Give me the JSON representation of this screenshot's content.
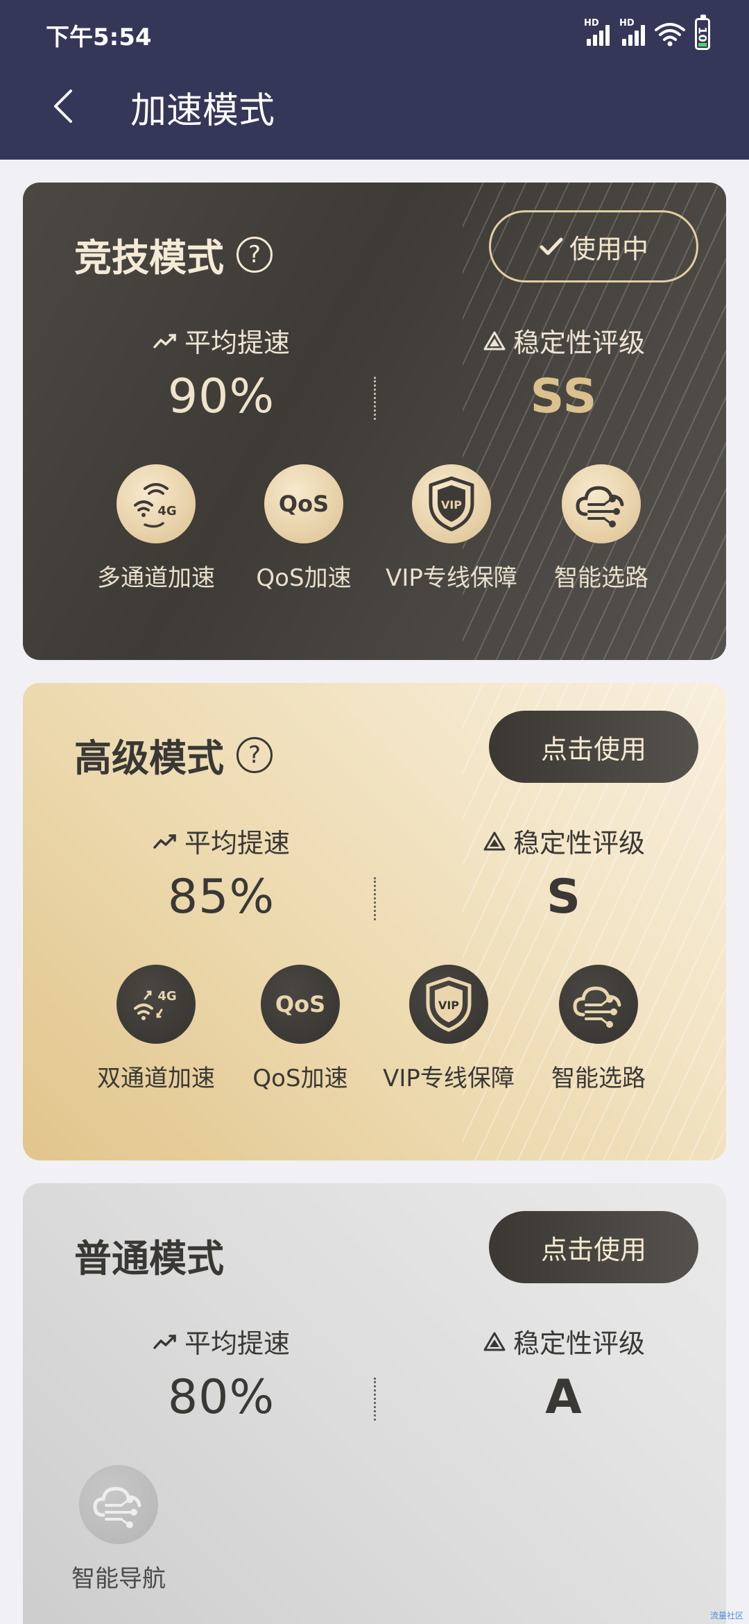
{
  "status_bar": {
    "time": "下午5:54",
    "signal1_label": "HD",
    "signal2_label": "HD",
    "battery_level": "10"
  },
  "nav": {
    "title": "加速模式"
  },
  "labels": {
    "avg_speed": "平均提速",
    "stability": "稳定性评级"
  },
  "cards": [
    {
      "title": "竞技模式",
      "help": "?",
      "button": "使用中",
      "avg_speed_value": "90%",
      "stability_value": "SS",
      "features": [
        "多通道加速",
        "QoS加速",
        "VIP专线保障",
        "智能选路"
      ]
    },
    {
      "title": "高级模式",
      "help": "?",
      "button": "点击使用",
      "avg_speed_value": "85%",
      "stability_value": "S",
      "features": [
        "双通道加速",
        "QoS加速",
        "VIP专线保障",
        "智能选路"
      ]
    },
    {
      "title": "普通模式",
      "button": "点击使用",
      "avg_speed_value": "80%",
      "stability_value": "A",
      "features": [
        "智能导航"
      ]
    }
  ],
  "icon_text": {
    "fourg": "4G",
    "qos": "QoS",
    "vip": "VIP"
  },
  "watermark": "流量社区"
}
